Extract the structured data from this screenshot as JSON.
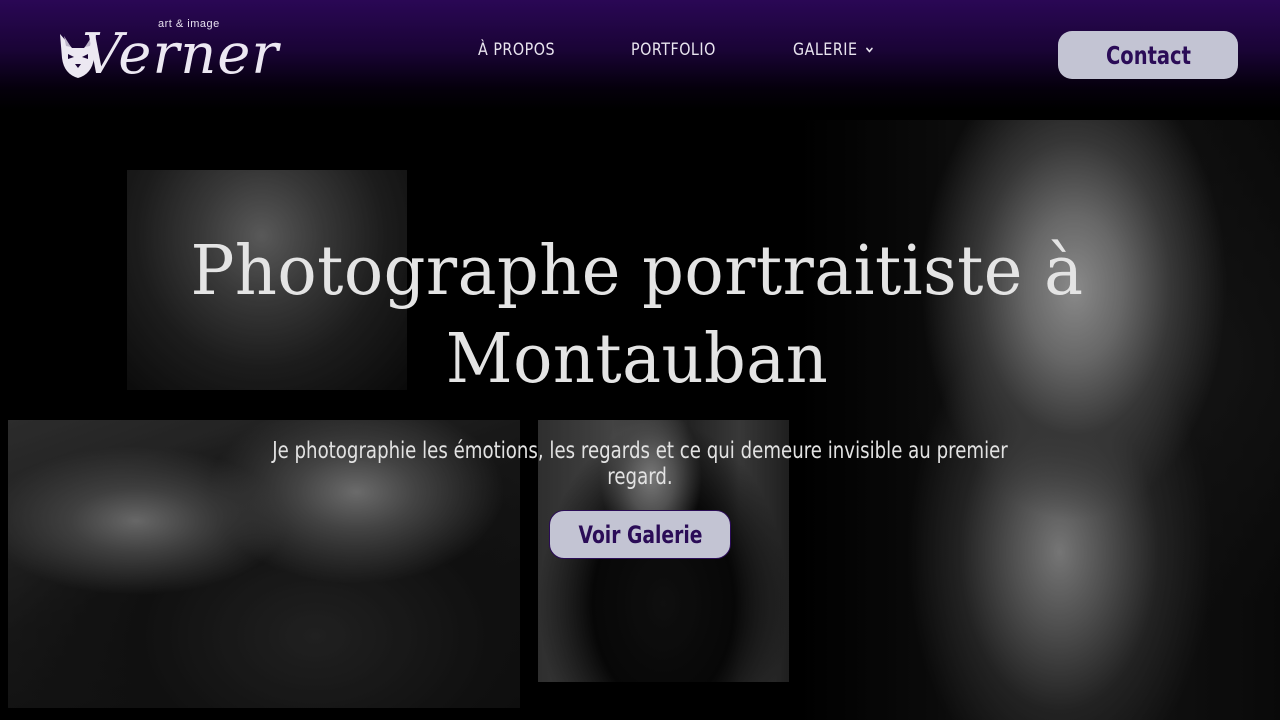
{
  "header": {
    "logo": {
      "tagline": "art & image",
      "wordmark": "Verner",
      "icon": "cat-head-icon"
    },
    "nav": {
      "items": [
        {
          "label": "À PROPOS",
          "has_dropdown": false
        },
        {
          "label": "PORTFOLIO",
          "has_dropdown": false
        },
        {
          "label": "GALERIE",
          "has_dropdown": true,
          "icon": "chevron-down-icon"
        }
      ]
    },
    "contact_label": "Contact"
  },
  "hero": {
    "title": "Photographe portraitiste à Montauban",
    "subtitle": "Je photographie les émotions, les regards et ce qui demeure invisible au premier regard.",
    "cta_label": "Voir Galerie"
  },
  "colors": {
    "header_top": "#2a0755",
    "button_bg": "#c3c4d3",
    "button_text": "#2b0c57",
    "text_light": "#e4e4e4",
    "page_bg": "#000000"
  }
}
